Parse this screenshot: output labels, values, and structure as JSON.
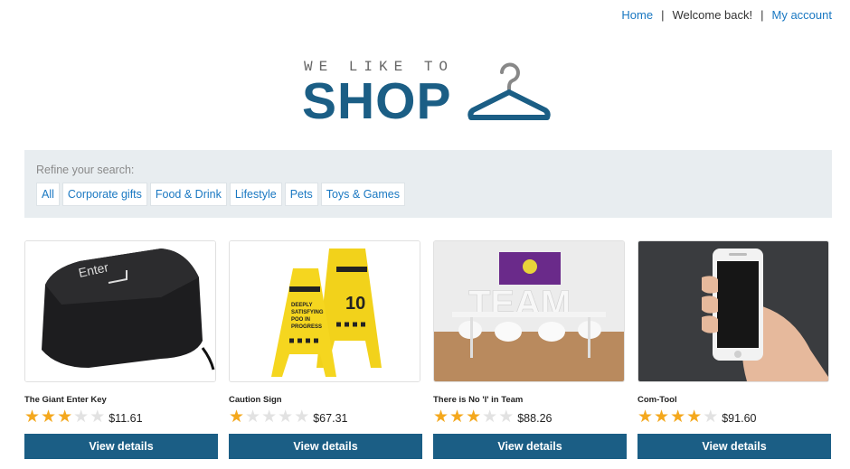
{
  "nav": {
    "home": "Home",
    "sep": "|",
    "welcome": "Welcome back!",
    "account": "My account"
  },
  "logo": {
    "tagline": "WE LIKE TO",
    "word": "SHOP"
  },
  "refine": {
    "label": "Refine your search:",
    "filters": [
      "All",
      "Corporate gifts",
      "Food & Drink",
      "Lifestyle",
      "Pets",
      "Toys & Games"
    ]
  },
  "products": [
    {
      "name": "The Giant Enter Key",
      "rating": 3,
      "price": "$11.61",
      "button": "View details",
      "image_text": "Enter"
    },
    {
      "name": "Caution Sign",
      "rating": 1,
      "price": "$67.31",
      "button": "View details",
      "image_text": "DEEPLY SATISFYING POO IN PROGRESS"
    },
    {
      "name": "There is No 'I' in Team",
      "rating": 3,
      "price": "$88.26",
      "button": "View details",
      "image_text": "TEAM"
    },
    {
      "name": "Com-Tool",
      "rating": 4,
      "price": "$91.60",
      "button": "View details"
    }
  ],
  "colors": {
    "brand": "#1b5e85",
    "link": "#1a78c2",
    "star": "#f4a81d",
    "panel": "#e8edf0"
  }
}
